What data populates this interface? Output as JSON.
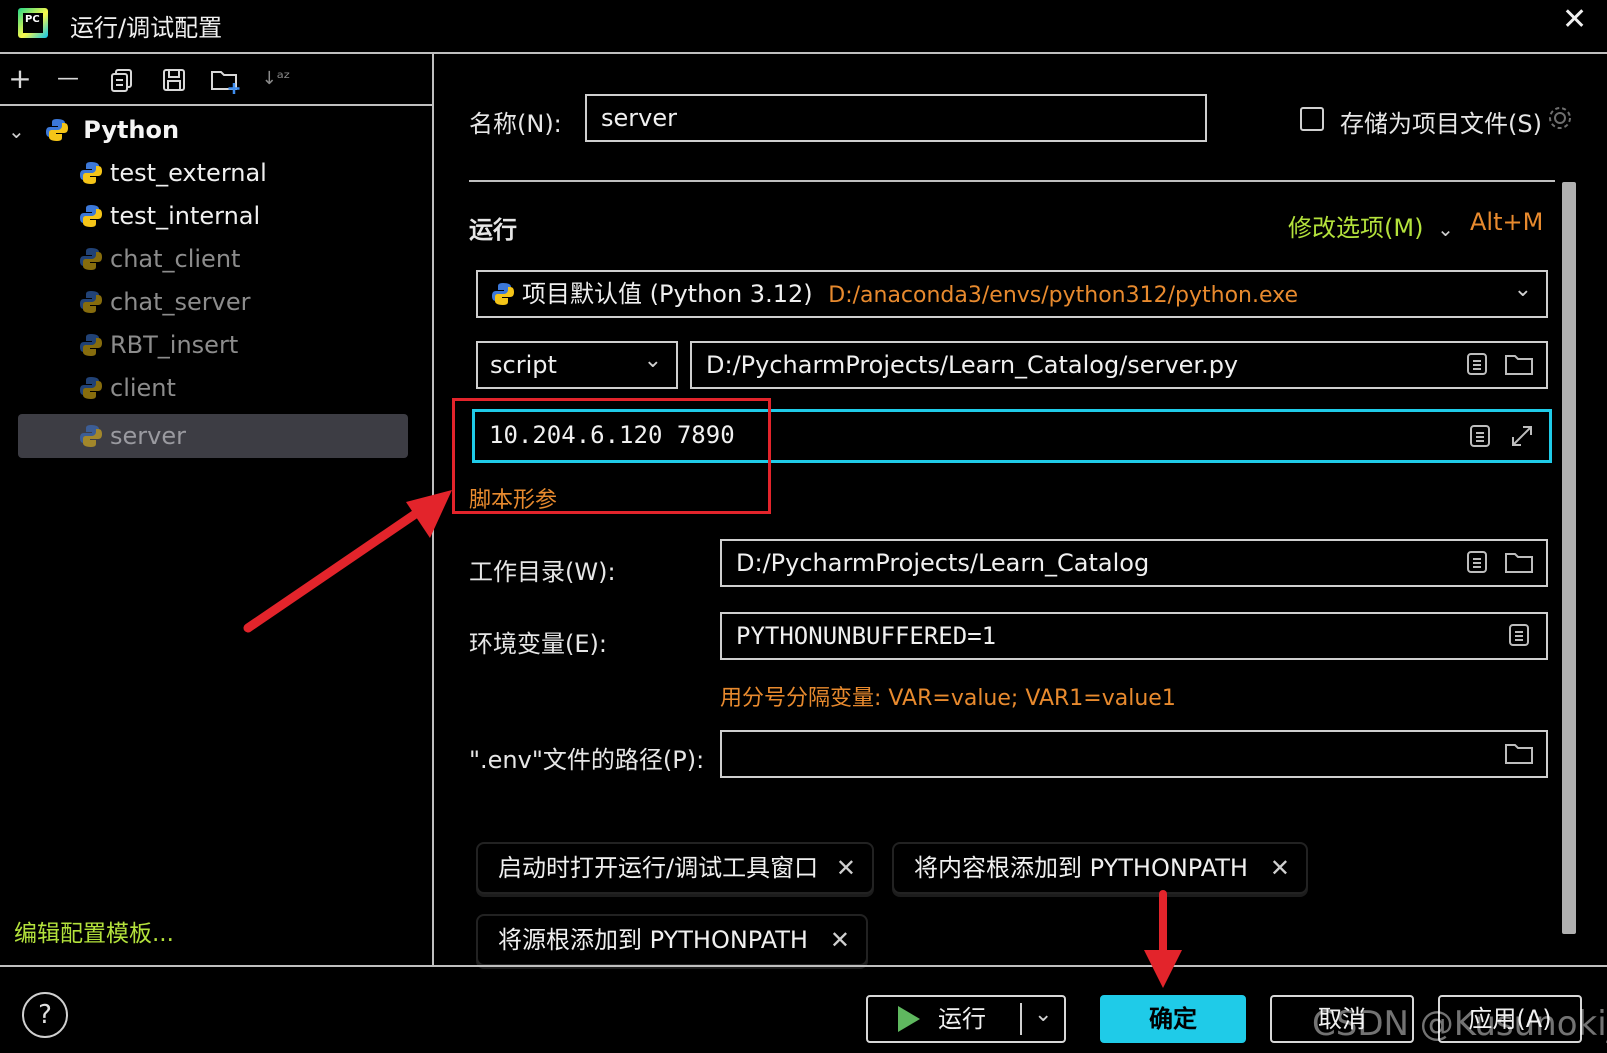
{
  "window": {
    "title": "运行/调试配置"
  },
  "toolbar": {
    "add": "+",
    "remove": "—",
    "sort": "↓ᵃᶻ"
  },
  "tree": {
    "group": "Python",
    "items": [
      {
        "label": "test_external"
      },
      {
        "label": "test_internal"
      },
      {
        "label": "chat_client"
      },
      {
        "label": "chat_server"
      },
      {
        "label": "RBT_insert"
      },
      {
        "label": "client"
      },
      {
        "label": "server"
      }
    ]
  },
  "edit_templates_link": "编辑配置模板...",
  "form": {
    "name_label": "名称(N):",
    "name_value": "server",
    "store_as_project_label": "存储为项目文件(S)",
    "run_section": "运行",
    "modify_options": "修改选项(M)",
    "modify_shortcut": "Alt+M",
    "interpreter_name": "项目默认值 (Python 3.12)",
    "interpreter_path": "D:/anaconda3/envs/python312/python.exe",
    "script_type": "script",
    "script_path": "D:/PycharmProjects/Learn_Catalog/server.py",
    "script_params": "10.204.6.120 7890",
    "script_params_hint": "脚本形参",
    "workdir_label": "工作目录(W):",
    "workdir_value": "D:/PycharmProjects/Learn_Catalog",
    "env_label": "环境变量(E):",
    "env_value": "PYTHONUNBUFFERED=1",
    "env_hint": "用分号分隔变量: VAR=value; VAR1=value1",
    "dotenv_label": "\".env\"文件的路径(P):",
    "dotenv_value": ""
  },
  "chips": [
    {
      "label": "启动时打开运行/调试工具窗口"
    },
    {
      "label": "将内容根添加到 PYTHONPATH"
    },
    {
      "label": "将源根添加到 PYTHONPATH"
    }
  ],
  "buttons": {
    "run": "运行",
    "ok": "确定",
    "cancel": "取消",
    "apply": "应用(A)"
  },
  "help": "?",
  "watermark": "CSDN @Kusunoki_D",
  "colors": {
    "accent_cyan": "#1fcbe8",
    "highlight_red": "#e3242b",
    "hint_orange": "#e88a2e",
    "link_green": "#b4e23c",
    "selection": "#3d3d44"
  }
}
